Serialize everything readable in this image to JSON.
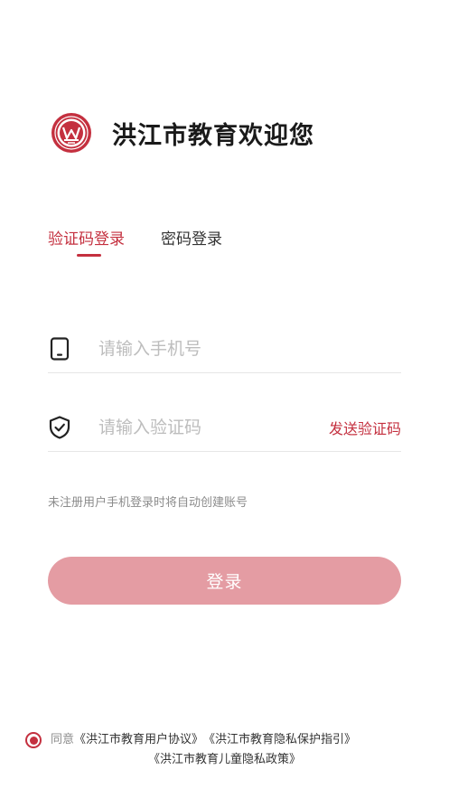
{
  "brand": {
    "title": "洪江市教育欢迎您",
    "logo_icon": "school-emblem-icon",
    "accent_color": "#c4303f"
  },
  "tabs": [
    {
      "label": "验证码登录",
      "active": true
    },
    {
      "label": "密码登录",
      "active": false
    }
  ],
  "phone_field": {
    "icon": "phone-icon",
    "placeholder": "请输入手机号",
    "value": ""
  },
  "code_field": {
    "icon": "shield-check-icon",
    "placeholder": "请输入验证码",
    "value": "",
    "send_label": "发送验证码"
  },
  "hint": "未注册用户手机登录时将自动创建账号",
  "login_button": {
    "label": "登录",
    "color": "#e49ca3"
  },
  "agreement": {
    "prefix": "同意",
    "links": [
      "《洪江市教育用户协议》",
      "《洪江市教育隐私保护指引》",
      "《洪江市教育儿童隐私政策》"
    ]
  }
}
